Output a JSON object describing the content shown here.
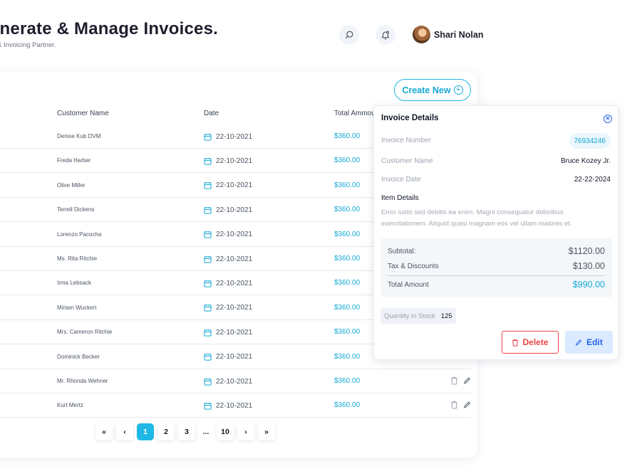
{
  "header": {
    "title": "enerate & Manage Invoices.",
    "subtitle": "& Invoicing Partner.",
    "user_name": "Shari Nolan",
    "icons": [
      "search-icon",
      "bell-icon"
    ]
  },
  "toolbar": {
    "create_label": "Create New"
  },
  "table": {
    "columns": {
      "customer": "Customer Name",
      "date": "Date",
      "amount": "Total Ammou"
    },
    "rows": [
      {
        "customer": "Denise Kub DVM",
        "date": "22-10-2021",
        "amount": "$360.00"
      },
      {
        "customer": "Freda Harber",
        "date": "22-10-2021",
        "amount": "$360.00"
      },
      {
        "customer": "Olive Miller",
        "date": "22-10-2021",
        "amount": "$360.00"
      },
      {
        "customer": "Terrell Dickens",
        "date": "22-10-2021",
        "amount": "$360.00"
      },
      {
        "customer": "Lorenzo Pacocha",
        "date": "22-10-2021",
        "amount": "$360.00"
      },
      {
        "customer": "Ms. Rita Ritchie",
        "date": "22-10-2021",
        "amount": "$360.00"
      },
      {
        "customer": "Irma Lebsack",
        "date": "22-10-2021",
        "amount": "$360.00"
      },
      {
        "customer": "Miriam Wuckert",
        "date": "22-10-2021",
        "amount": "$360.00"
      },
      {
        "customer": "Mrs. Cameron Ritchie",
        "date": "22-10-2021",
        "amount": "$360.00"
      },
      {
        "customer": "Dominick Becker",
        "date": "22-10-2021",
        "amount": "$360.00"
      },
      {
        "customer": "Mr. Rhonda Wehner",
        "date": "22-10-2021",
        "amount": "$360.00"
      },
      {
        "customer": "Kurt Mertz",
        "date": "22-10-2021",
        "amount": "$360.00"
      }
    ]
  },
  "pagination": {
    "first": "«",
    "prev": "‹",
    "pages": [
      "1",
      "2",
      "3",
      "...",
      "10"
    ],
    "current": "1",
    "next": "›",
    "last": "»"
  },
  "invoice_details": {
    "title": "Invoice Details",
    "invoice_number_label": "Invoice Number",
    "invoice_number": "76934246",
    "customer_label": "Customer Name",
    "customer": "Bruce Kozey Jr.",
    "date_label": "Invoice Date",
    "date": "22-22-2024",
    "items_title": "Item Details",
    "items_description": "Error iusto sed debitis ea enim. Magni consequatur doloribus exercitationem. Aliquid quasi magnam eos vel ullam maiores et.",
    "subtotal_label": "Subtotal:",
    "subtotal": "$1120.00",
    "tax_label": "Tax & Discounts",
    "tax": "$130.00",
    "total_label": "Total Amount",
    "total": "$990.00",
    "qty_label": "Quantity in Stock",
    "qty": "125",
    "delete_label": "Delete",
    "edit_label": "Edit"
  },
  "colors": {
    "accent": "#1fb8e4",
    "danger": "#ef4444",
    "primary": "#2563eb"
  }
}
